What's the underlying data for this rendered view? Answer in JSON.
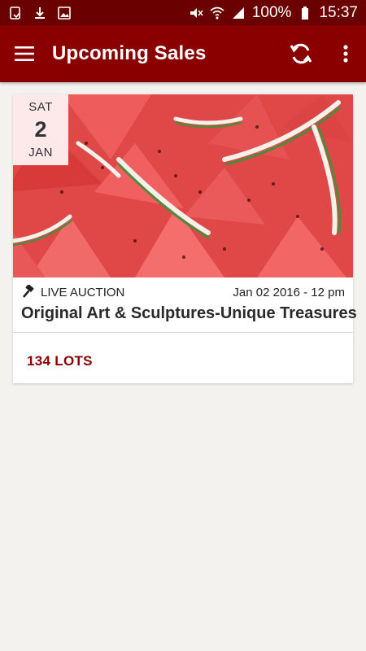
{
  "status_bar": {
    "battery": "100%",
    "time": "15:37",
    "icons": [
      "screenshot-icon",
      "download-icon",
      "image-icon",
      "mute-icon",
      "wifi-icon",
      "signal-icon",
      "battery-icon"
    ]
  },
  "app_bar": {
    "title": "Upcoming Sales",
    "menu_icon": "menu-icon",
    "refresh_icon": "refresh-icon",
    "overflow_icon": "overflow-icon"
  },
  "sales": [
    {
      "date": {
        "dow": "SAT",
        "day": "2",
        "month": "JAN"
      },
      "type": "LIVE AUCTION",
      "datetime": "Jan 02 2016 - 12 pm",
      "title": "Original Art & Sculptures-Unique Treasures",
      "lots": "134 LOTS",
      "image": "watermelon-slices"
    }
  ],
  "colors": {
    "primary": "#8a0000",
    "primary_dark": "#6a0000",
    "background": "#f3f2ef",
    "accent_text": "#8a0000"
  }
}
